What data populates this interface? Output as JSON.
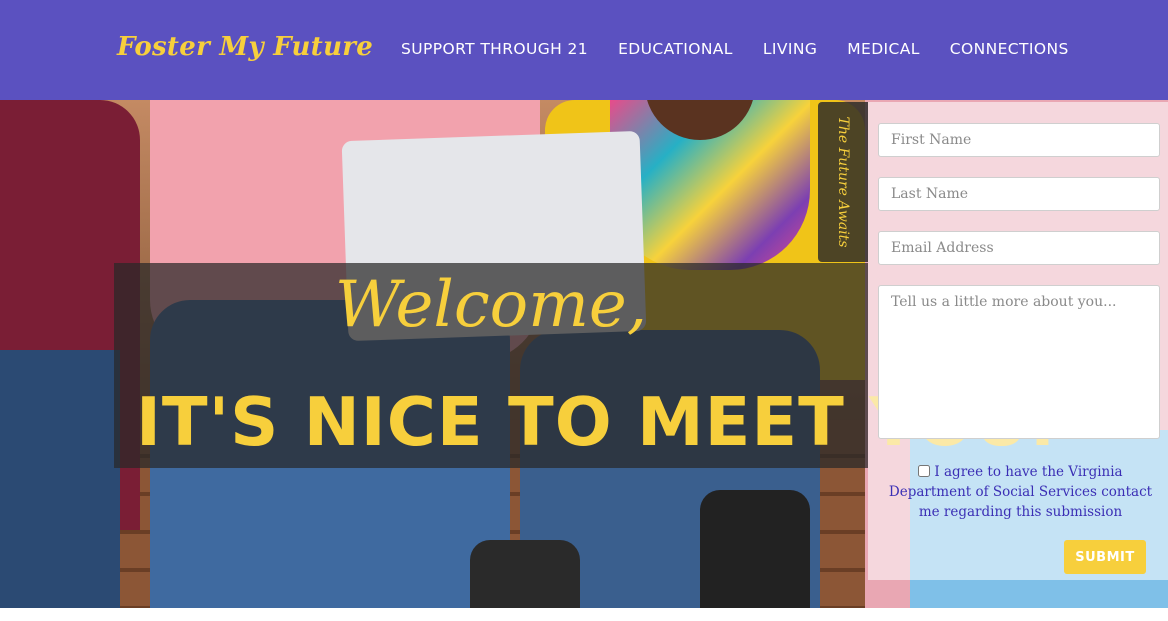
{
  "header": {
    "logo": "Foster My Future",
    "nav": [
      {
        "label": "SUPPORT THROUGH 21"
      },
      {
        "label": "EDUCATIONAL"
      },
      {
        "label": "LIVING"
      },
      {
        "label": "MEDICAL"
      },
      {
        "label": "CONNECTIONS"
      }
    ]
  },
  "hero": {
    "welcome_script": "Welcome,",
    "welcome_big": "IT'S NICE TO MEET YOU."
  },
  "side_tab": {
    "label": "The Future Awaits"
  },
  "form": {
    "first_name_placeholder": "First Name",
    "last_name_placeholder": "Last Name",
    "email_placeholder": "Email Address",
    "message_placeholder": "Tell us a little more about you...",
    "consent_text": "I agree to have the Virginia Department of Social Services contact me regarding this submission",
    "consent_checked": false,
    "submit_label": "SUBMIT"
  },
  "colors": {
    "header_bg": "#5b51c0",
    "accent_yellow": "#f7cf3c",
    "consent_text": "#3b2fb5"
  }
}
